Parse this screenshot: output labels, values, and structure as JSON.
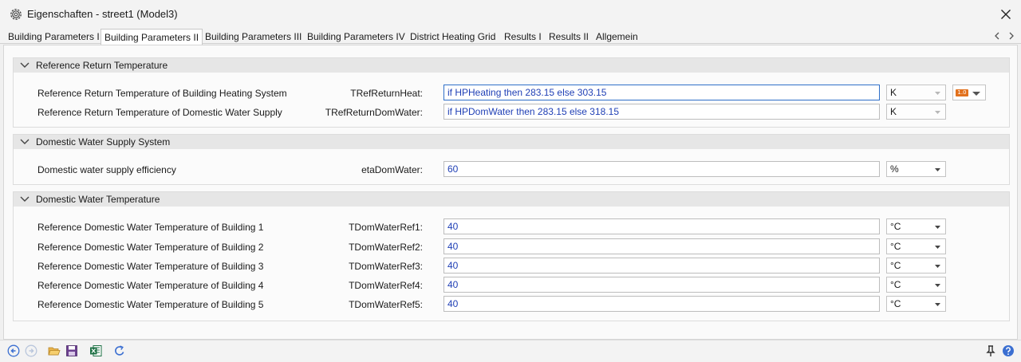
{
  "window": {
    "title": "Eigenschaften - street1 (Model3)"
  },
  "tabs": [
    {
      "label": "Building Parameters I"
    },
    {
      "label": "Building Parameters II"
    },
    {
      "label": "Building Parameters III"
    },
    {
      "label": "Building Parameters IV"
    },
    {
      "label": "District Heating Grid"
    },
    {
      "label": "Results I"
    },
    {
      "label": "Results II"
    },
    {
      "label": "Allgemein"
    }
  ],
  "active_tab": "Building Parameters II",
  "groups": [
    {
      "title": "Reference Return Temperature",
      "rows": [
        {
          "description": "Reference Return Temperature of Building Heating System",
          "name": "TRefReturnHeat:",
          "value": "if HPHeating then 283.15 else 303.15",
          "unit": "K"
        },
        {
          "description": "Reference Return Temperature of Domestic Water Supply",
          "name": "TRefReturnDomWater:",
          "value": "if HPDomWater then 283.15 else 318.15",
          "unit": "K"
        }
      ]
    },
    {
      "title": "Domestic Water Supply System",
      "rows": [
        {
          "description": "Domestic water supply efficiency",
          "name": "etaDomWater:",
          "value": "60",
          "unit": "%"
        }
      ]
    },
    {
      "title": "Domestic Water Temperature",
      "rows": [
        {
          "description": "Reference Domestic Water Temperature of Building 1",
          "name": "TDomWaterRef1:",
          "value": "40",
          "unit": "°C"
        },
        {
          "description": "Reference Domestic Water Temperature of Building 2",
          "name": "TDomWaterRef2:",
          "value": "40",
          "unit": "°C"
        },
        {
          "description": "Reference Domestic Water Temperature of Building 3",
          "name": "TDomWaterRef3:",
          "value": "40",
          "unit": "°C"
        },
        {
          "description": "Reference Domestic Water Temperature of Building 4",
          "name": "TDomWaterRef4:",
          "value": "40",
          "unit": "°C"
        },
        {
          "description": "Reference Domestic Water Temperature of Building 5",
          "name": "TDomWaterRef5:",
          "value": "40",
          "unit": "°C"
        }
      ]
    }
  ],
  "variant_button": {
    "badge": "1.0",
    "icon": "variable-type-icon"
  },
  "colors": {
    "value_text": "#1f3fb5",
    "badge": "#e2711d",
    "excel": "#1d7044",
    "nav_icon": "#3b6fd1"
  },
  "toolbar_icons": [
    "back-icon",
    "forward-icon",
    "open-folder-icon",
    "save-icon",
    "excel-export-icon",
    "refresh-icon",
    "pin-icon",
    "help-icon"
  ]
}
